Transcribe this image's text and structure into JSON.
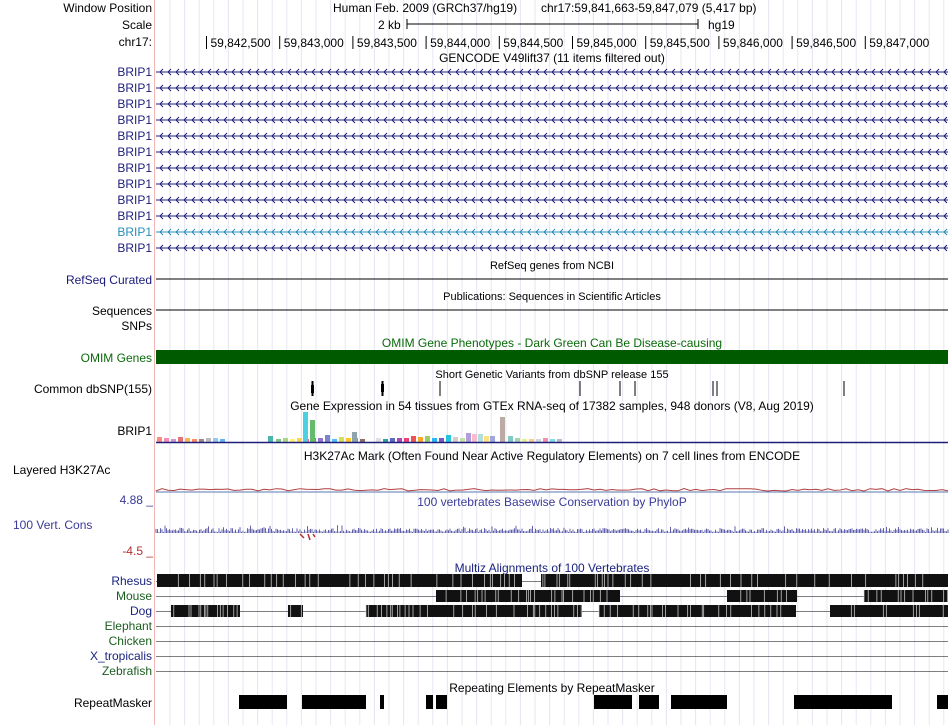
{
  "header": {
    "window_position_label": "Window Position",
    "scale_label": "Scale",
    "chrom_label": "chr17:",
    "assembly": "Human Feb. 2009 (GRCh37/hg19)",
    "position": "chr17:59,841,663-59,847,079 (5,417 bp)",
    "scale_text": "2 kb",
    "db": "hg19",
    "ruler_ticks": [
      "59,842,500",
      "59,843,000",
      "59,843,500",
      "59,844,000",
      "59,844,500",
      "59,845,000",
      "59,845,500",
      "59,846,000",
      "59,846,500",
      "59,847,000"
    ]
  },
  "gencode": {
    "title": "GENCODE V49lift37 (11 items filtered out)",
    "items": [
      "BRIP1",
      "BRIP1",
      "BRIP1",
      "BRIP1",
      "BRIP1",
      "BRIP1",
      "BRIP1",
      "BRIP1",
      "BRIP1",
      "BRIP1",
      "BRIP1",
      "BRIP1"
    ],
    "highlight_index": 10
  },
  "refseq": {
    "label": "RefSeq Curated",
    "title": "RefSeq genes from NCBI"
  },
  "publications": {
    "label": "Sequences",
    "title": "Publications: Sequences in Scientific Articles"
  },
  "snps": {
    "label": "SNPs"
  },
  "omim": {
    "label": "OMIM Genes",
    "title": "OMIM Gene Phenotypes - Dark Green Can Be Disease-causing"
  },
  "dbsnp": {
    "label": "Common dbSNP(155)",
    "title": "Short Genetic Variants from dbSNP release 155"
  },
  "gtex": {
    "label": "BRIP1",
    "title": "Gene Expression in 54 tissues from GTEx RNA-seq of 17382 samples, 948 donors (V8, Aug 2019)"
  },
  "h3k27ac": {
    "label": "Layered H3K27Ac",
    "title": "H3K27Ac Mark (Often Found Near Active Regulatory Elements) on 7 cell lines from ENCODE"
  },
  "phylop": {
    "label": "100 Vert. Cons",
    "max": "4.88 _",
    "min": "-4.5 _",
    "title": "100 vertebrates Basewise Conservation by PhyloP"
  },
  "multiz": {
    "title": "Multiz Alignments of 100 Vertebrates",
    "species": [
      {
        "name": "Rhesus",
        "color": "#1a237e"
      },
      {
        "name": "Mouse",
        "color": "#1b5e20"
      },
      {
        "name": "Dog",
        "color": "#1a237e"
      },
      {
        "name": "Elephant",
        "color": "#1b5e20"
      },
      {
        "name": "Chicken",
        "color": "#1b5e20"
      },
      {
        "name": "X_tropicalis",
        "color": "#1a237e"
      },
      {
        "name": "Zebrafish",
        "color": "#1b5e20"
      }
    ]
  },
  "repeatmasker": {
    "label": "RepeatMasker",
    "title": "Repeating Elements by RepeatMasker"
  },
  "colors": {
    "gene": "#1f1f7a",
    "gene_highlight": "#2a8db8",
    "omim": "#005a00",
    "omim_title": "#0a6a0a",
    "phylop": "#3a3a9a",
    "label_blue": "#1a1a7a"
  }
}
